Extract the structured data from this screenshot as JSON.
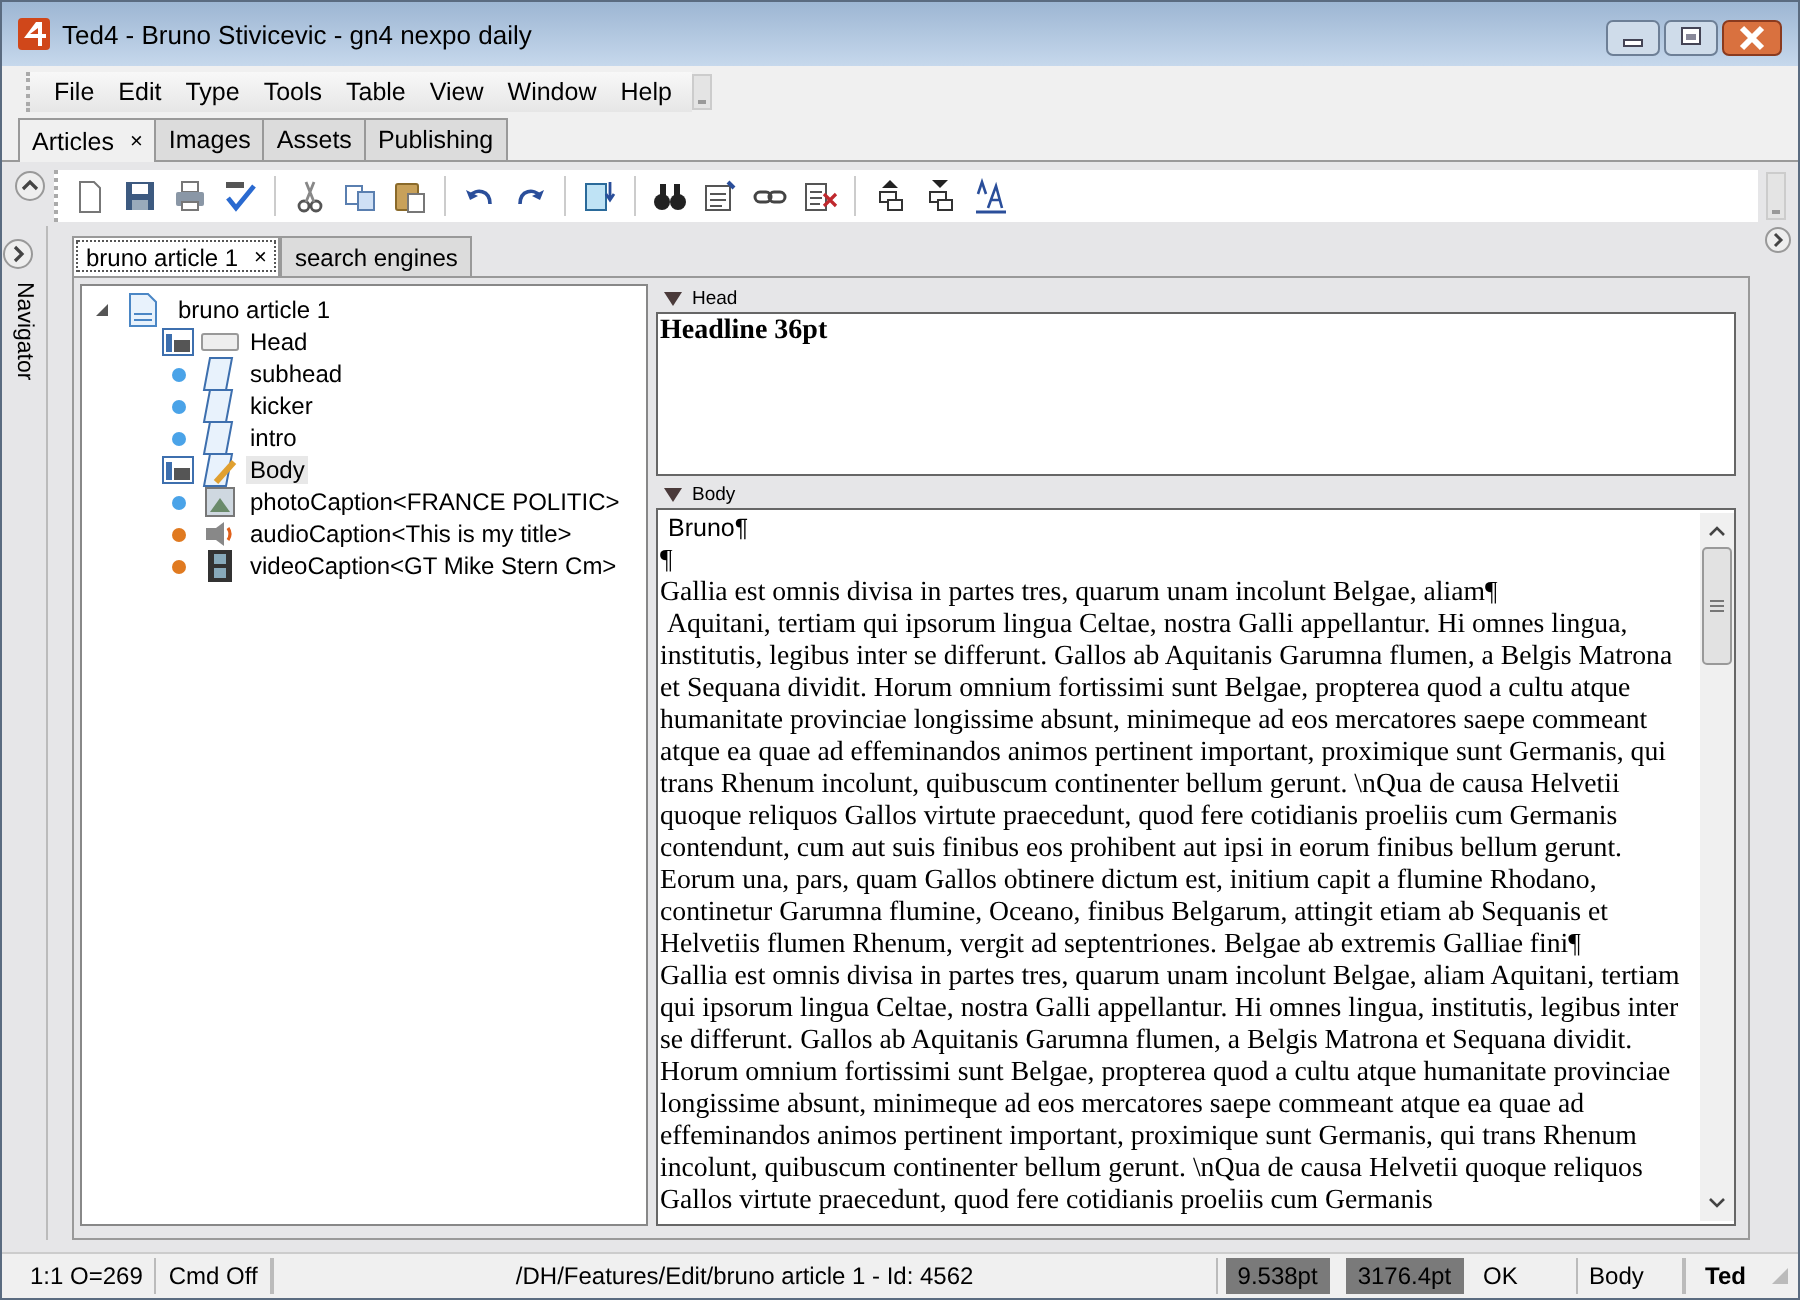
{
  "window": {
    "title": "Ted4 - Bruno Stivicevic - gn4 nexpo daily"
  },
  "menu": [
    {
      "label": "File"
    },
    {
      "label": "Edit"
    },
    {
      "label": "Type"
    },
    {
      "label": "Tools"
    },
    {
      "label": "Table"
    },
    {
      "label": "View"
    },
    {
      "label": "Window"
    },
    {
      "label": "Help"
    }
  ],
  "tabs": [
    {
      "label": "Articles",
      "selected": true,
      "close": "×"
    },
    {
      "label": "Images",
      "selected": false
    },
    {
      "label": "Assets",
      "selected": false
    },
    {
      "label": "Publishing",
      "selected": false
    }
  ],
  "navigator": {
    "label": "Navigator"
  },
  "doc_tabs": [
    {
      "label": "bruno article 1",
      "selected": true,
      "close": "×"
    },
    {
      "label": "search engines",
      "selected": false
    }
  ],
  "tree": {
    "label": "bruno article 1",
    "expanded": true,
    "children": [
      {
        "label": "Head",
        "kind": "head",
        "selected": false
      },
      {
        "label": "subhead",
        "kind": "text",
        "color": "#4aa3e8",
        "selected": false
      },
      {
        "label": "kicker",
        "kind": "text",
        "color": "#4aa3e8",
        "selected": false
      },
      {
        "label": "intro",
        "kind": "text",
        "color": "#4aa3e8",
        "selected": false
      },
      {
        "label": "Body",
        "kind": "body",
        "selected": true
      },
      {
        "label": "photoCaption<FRANCE POLITIC>",
        "kind": "photo",
        "color": "#4aa3e8",
        "selected": false
      },
      {
        "label": "audioCaption<This is my title>",
        "kind": "audio",
        "color": "#e07a20",
        "selected": false
      },
      {
        "label": "videoCaption<GT Mike Stern Cm>",
        "kind": "video",
        "color": "#e07a20",
        "selected": false
      }
    ]
  },
  "editor": [
    {
      "label": "Head",
      "expanded": true,
      "kind": "head",
      "paragraphs": [
        "Headline 36pt"
      ]
    },
    {
      "label": "Body",
      "expanded": true,
      "kind": "body",
      "paragraphs": [
        "Bruno¶",
        "¶",
        "Gallia est omnis divisa in partes tres, quarum unam incolunt Belgae, aliam¶",
        " Aquitani, tertiam qui ipsorum lingua Celtae, nostra Galli appellantur. Hi omnes lingua, institutis, legibus inter se differunt. Gallos ab Aquitanis Garumna flumen, a Belgis Matrona et Sequana dividit. Horum omnium fortissimi sunt Belgae, propterea quod a cultu atque humanitate provinciae longissime absunt, minimeque ad eos mercatores saepe commeant atque ea quae ad effeminandos animos pertinent important, proximique sunt Germanis, qui trans Rhenum incolunt, quibuscum continenter bellum gerunt. \\nQua de causa Helvetii quoque reliquos Gallos virtute praecedunt, quod fere cotidianis proeliis cum Germanis contendunt, cum aut suis finibus eos prohibent aut ipsi in eorum finibus bellum gerunt. Eorum una, pars, quam Gallos obtinere dictum est, initium capit a flumine Rhodano, continetur Garumna flumine, Oceano, finibus Belgarum, attingit etiam ab Sequanis et Helvetiis flumen Rhenum, vergit ad septentriones. Belgae ab extremis Galliae fini¶",
        "Gallia est omnis divisa in partes tres, quarum unam incolunt Belgae, aliam Aquitani, tertiam qui ipsorum lingua Celtae, nostra Galli appellantur. Hi omnes lingua, institutis, legibus inter se differunt. Gallos ab Aquitanis Garumna flumen, a Belgis Matrona et Sequana dividit. Horum omnium fortissimi sunt Belgae, propterea quod a cultu atque humanitate provinciae longissime absunt, minimeque ad eos mercatores saepe commeant atque ea quae ad effeminandos animos pertinent important, proximique sunt Germanis, qui trans Rhenum incolunt, quibuscum continenter bellum gerunt. \\nQua de causa Helvetii quoque reliquos Gallos virtute praecedunt, quod fere cotidianis proeliis cum Germanis"
      ]
    }
  ],
  "status_bar": [
    {
      "text": "1:1  O=269",
      "kind": "plain"
    },
    {
      "text": "Cmd Off",
      "kind": "plain"
    },
    {
      "text": "/DH/Features/Edit/bruno article 1 - Id: 4562",
      "kind": "path"
    },
    {
      "text": "9.538pt",
      "kind": "highlight"
    },
    {
      "text": "3176.4pt",
      "kind": "highlight"
    },
    {
      "text": "OK",
      "kind": "plain"
    },
    {
      "text": "Body",
      "kind": "plain"
    },
    {
      "text": "Ted",
      "kind": "bold"
    }
  ]
}
